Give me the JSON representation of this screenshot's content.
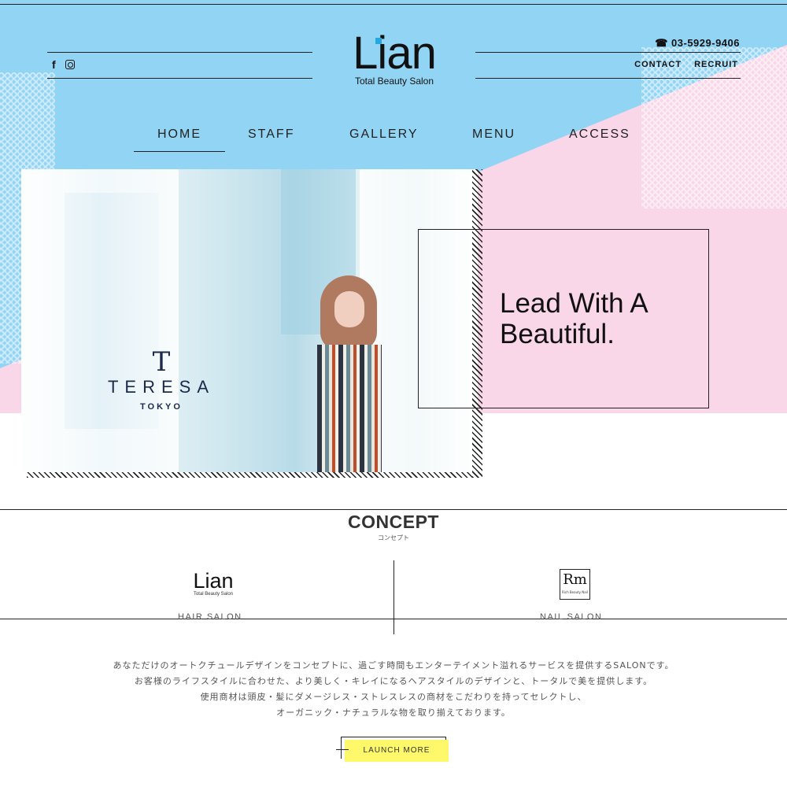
{
  "colors": {
    "sky_blue": "#92d4f4",
    "pink": "#fad7e8",
    "button_yellow": "#fff86a",
    "accent_blue": "#27a7e0"
  },
  "header": {
    "social": [
      {
        "icon": "facebook-icon",
        "glyph": "f"
      },
      {
        "icon": "instagram-icon"
      }
    ],
    "logo": {
      "title": "Lian",
      "subtitle": "Total Beauty Salon"
    },
    "phone": "☎ 03-5929-9406",
    "links": [
      "CONTACT",
      "RECRUIT"
    ]
  },
  "nav": {
    "items": [
      "HOME",
      "STAFF",
      "GALLERY",
      "MENU",
      "ACCESS"
    ],
    "active": "HOME"
  },
  "hero": {
    "brand": {
      "mark": "T",
      "name": "TERESA",
      "city": "TOKYO"
    },
    "tagline": "Lead With A\nBeautiful."
  },
  "concept": {
    "title": "CONCEPT",
    "subtitle": "コンセプト",
    "hair": {
      "logo_title": "Lian",
      "logo_sub": "Total Beauty Salon",
      "label": "HAIR SALON"
    },
    "nail": {
      "logo_title": "Rm",
      "logo_sub": "Rich Beauty Nail",
      "label": "NAIL SALON"
    },
    "body": [
      "あなただけのオートクチュールデザインをコンセプトに、過ごす時間もエンターテイメント溢れるサービスを提供するSALONです。",
      "お客様のライフスタイルに合わせた、より美しく・キレイになるヘアスタイルのデザインと、トータルで美を提供します。",
      "使用商材は頭皮・髪にダメージレス・ストレスレスの商材をこだわりを持ってセレクトし、",
      "オーガニック・ナチュラルな物を取り揃えております。"
    ],
    "button": "LAUNCH MORE"
  }
}
